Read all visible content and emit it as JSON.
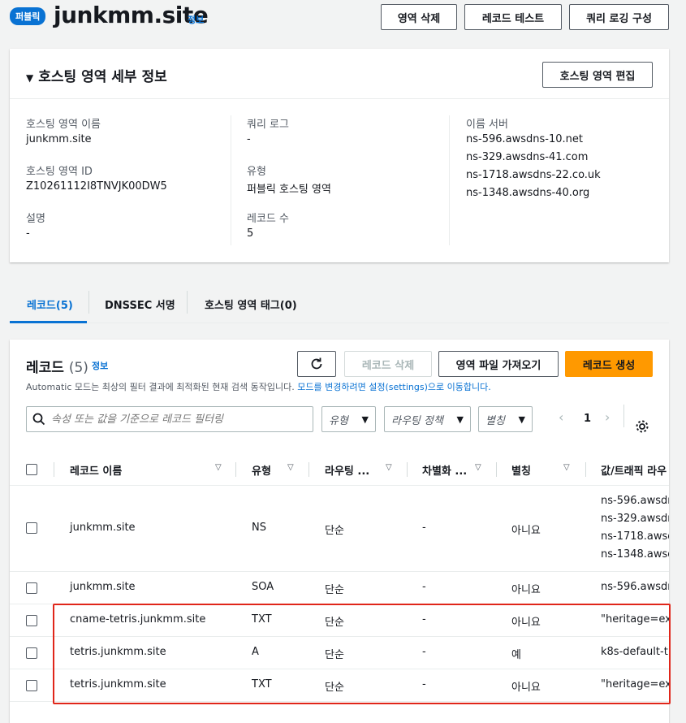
{
  "header": {
    "badge": "퍼블릭",
    "title": "junkmm.site",
    "info": "정보",
    "buttons": {
      "delete_zone": "영역 삭제",
      "test_record": "레코드 테스트",
      "query_logging": "쿼리 로깅 구성"
    }
  },
  "details": {
    "title": "호스팅 영역 세부 정보",
    "edit_button": "호스팅 영역 편집",
    "zone_name_label": "호스팅 영역 이름",
    "zone_name": "junkmm.site",
    "zone_id_label": "호스팅 영역 ID",
    "zone_id": "Z10261112I8TNVJK00DW5",
    "description_label": "설명",
    "description": "-",
    "query_log_label": "쿼리 로그",
    "query_log": "-",
    "type_label": "유형",
    "type": "퍼블릭 호스팅 영역",
    "record_count_label": "레코드 수",
    "record_count": "5",
    "name_servers_label": "이름 서버",
    "name_servers": [
      "ns-596.awsdns-10.net",
      "ns-329.awsdns-41.com",
      "ns-1718.awsdns-22.co.uk",
      "ns-1348.awsdns-40.org"
    ]
  },
  "tabs": [
    "레코드(5)",
    "DNSSEC 서명",
    "호스팅 영역 태그(0)"
  ],
  "records": {
    "title": "레코드",
    "count": "(5)",
    "info": "정보",
    "refresh_icon": "refresh-icon",
    "delete_button": "레코드 삭제",
    "import_button": "영역 파일 가져오기",
    "create_button": "레코드 생성",
    "notice": "Automatic 모드는 최상의 필터 결과에 최적화된 현재 검색 동작입니다.",
    "notice_link": "모드를 변경하려면 설정(settings)으로 이동합니다.",
    "search_placeholder": "속성 또는 값을 기준으로 레코드 필터링",
    "filter_type": "유형",
    "filter_routing": "라우팅 정책",
    "filter_alias": "별칭",
    "page": "1",
    "columns": [
      "레코드 이름",
      "유형",
      "라우팅 ...",
      "차별화 ...",
      "별칭",
      "값/트래픽 라우"
    ],
    "rows": [
      {
        "name": "junkmm.site",
        "type": "NS",
        "routing": "단순",
        "diff": "-",
        "alias": "아니요",
        "values": [
          "ns-596.awsdr",
          "ns-329.awsdr",
          "ns-1718.awsd",
          "ns-1348.awsd"
        ]
      },
      {
        "name": "junkmm.site",
        "type": "SOA",
        "routing": "단순",
        "diff": "-",
        "alias": "아니요",
        "values": [
          "ns-596.awsdr"
        ]
      },
      {
        "name": "cname-tetris.junkmm.site",
        "type": "TXT",
        "routing": "단순",
        "diff": "-",
        "alias": "아니요",
        "values": [
          "\"heritage=ex"
        ]
      },
      {
        "name": "tetris.junkmm.site",
        "type": "A",
        "routing": "단순",
        "diff": "-",
        "alias": "예",
        "values": [
          "k8s-default-t"
        ]
      },
      {
        "name": "tetris.junkmm.site",
        "type": "TXT",
        "routing": "단순",
        "diff": "-",
        "alias": "아니요",
        "values": [
          "\"heritage=ex"
        ]
      }
    ]
  },
  "colors": {
    "accent": "#0972d3",
    "primary": "#ff9900",
    "highlight": "#e0261a"
  }
}
